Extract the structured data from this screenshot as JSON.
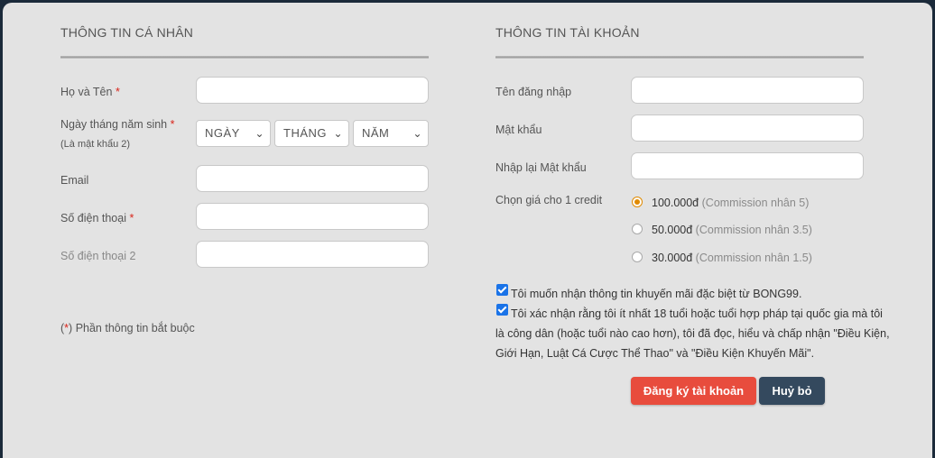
{
  "personal": {
    "title": "THÔNG TIN CÁ NHÂN",
    "full_name_label": "Họ và Tên",
    "dob_label": "Ngày tháng năm sinh",
    "dob_note": "(Là mật khẩu 2)",
    "day_select": "NGÀY",
    "month_select": "THÁNG",
    "year_select": "NĂM",
    "email_label": "Email",
    "phone_label": "Số điện thoại",
    "phone2_label": "Số điện thoại 2",
    "required_mark": "*",
    "required_note_open": "(",
    "required_note_close": ")",
    "required_note_text": " Phần thông tin bắt buộc"
  },
  "account": {
    "title": "THÔNG TIN TÀI KHOẢN",
    "username_label": "Tên đăng nhập",
    "password_label": "Mật khẩu",
    "confirm_password_label": "Nhập lại Mật khẩu",
    "credit_label": "Chọn giá cho 1 credit",
    "credit_options": [
      {
        "price": "100.000đ",
        "commission": "(Commission nhân 5)",
        "selected": true
      },
      {
        "price": "50.000đ",
        "commission": "(Commission nhân 3.5)",
        "selected": false
      },
      {
        "price": "30.000đ",
        "commission": "(Commission nhân 1.5)",
        "selected": false
      }
    ]
  },
  "agreements": {
    "promo_text": "Tôi muốn nhận thông tin khuyến mãi đặc biệt từ BONG99.",
    "promo_checked": true,
    "terms_line1": "Tôi xác nhận rằng tôi ít nhất 18 tuổi hoặc tuổi hợp pháp tại quốc gia mà tôi",
    "terms_line2": "là công dân (hoặc tuổi nào cao hơn), tôi đã đọc, hiểu và chấp nhận \"Điều Kiện,",
    "terms_line3": "Giới Hạn, Luật Cá Cược Thể Thao\" và \"Điều Kiện Khuyến Mãi\".",
    "terms_checked": true
  },
  "buttons": {
    "register": "Đăng ký tài khoản",
    "cancel": "Huỷ bỏ"
  },
  "colors": {
    "register_bg": "#e84c3d",
    "cancel_bg": "#34495e",
    "radio_accent": "#e08a00",
    "checkbox_accent": "#1a73e8",
    "required": "#d9241a"
  }
}
